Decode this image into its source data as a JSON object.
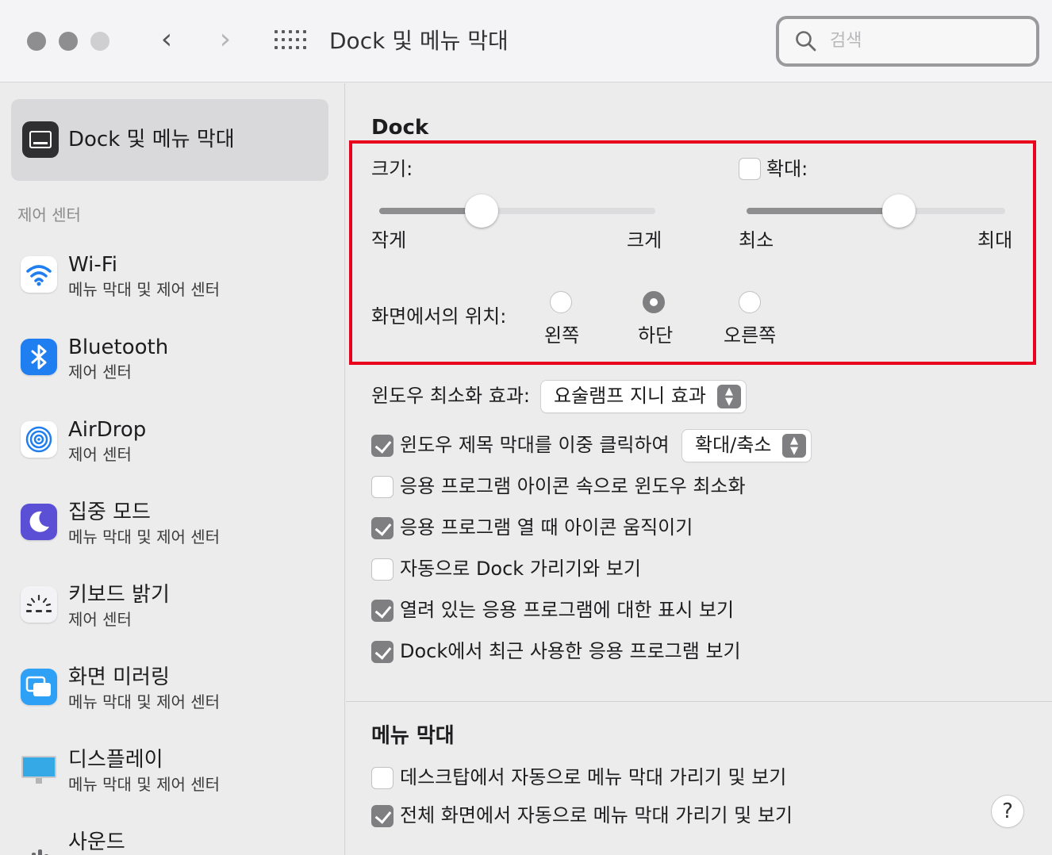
{
  "window": {
    "title": "Dock 및 메뉴 막대",
    "search_placeholder": "검색",
    "nav_back": "‹",
    "nav_forward": "›"
  },
  "sidebar": {
    "selected_label": "Dock 및 메뉴 막대",
    "section_header": "제어 센터",
    "items": [
      {
        "title": "Wi-Fi",
        "subtitle": "메뉴 막대 및 제어 센터",
        "icon": "wifi-icon"
      },
      {
        "title": "Bluetooth",
        "subtitle": "제어 센터",
        "icon": "bluetooth-icon"
      },
      {
        "title": "AirDrop",
        "subtitle": "제어 센터",
        "icon": "airdrop-icon"
      },
      {
        "title": "집중 모드",
        "subtitle": "메뉴 막대 및 제어 센터",
        "icon": "moon-icon"
      },
      {
        "title": "키보드 밝기",
        "subtitle": "제어 센터",
        "icon": "keyboard-brightness-icon"
      },
      {
        "title": "화면 미러링",
        "subtitle": "메뉴 막대 및 제어 센터",
        "icon": "screen-mirroring-icon"
      },
      {
        "title": "디스플레이",
        "subtitle": "메뉴 막대 및 제어 센터",
        "icon": "display-icon"
      },
      {
        "title": "사운드",
        "subtitle": "",
        "icon": "sound-icon"
      }
    ]
  },
  "dock": {
    "heading": "Dock",
    "size_label": "크기:",
    "size_min": "작게",
    "size_max": "크게",
    "size_value": 0.37,
    "magnify_label": "확대:",
    "magnify_checked": false,
    "magnify_min": "최소",
    "magnify_max": "최대",
    "magnify_value": 0.59,
    "position_label": "화면에서의 위치:",
    "position_options": [
      "왼쪽",
      "하단",
      "오른쪽"
    ],
    "position_selected": "하단",
    "minimize_label": "윈도우 최소화 효과:",
    "minimize_value": "요술램프 지니 효과",
    "options": [
      {
        "label": "윈도우 제목 막대를 이중 클릭하여",
        "checked": true
      },
      {
        "label": "응용 프로그램 아이콘 속으로 윈도우 최소화",
        "checked": false
      },
      {
        "label": "응용 프로그램 열 때 아이콘 움직이기",
        "checked": true
      },
      {
        "label": "자동으로 Dock 가리기와 보기",
        "checked": false
      },
      {
        "label": "열려 있는 응용 프로그램에 대한 표시 보기",
        "checked": true
      },
      {
        "label": "Dock에서 최근 사용한 응용 프로그램 보기",
        "checked": true
      }
    ],
    "double_click_value": "확대/축소"
  },
  "menubar": {
    "heading": "메뉴 막대",
    "options": [
      {
        "label": "데스크탑에서 자동으로 메뉴 막대 가리기 및 보기",
        "checked": false
      },
      {
        "label": "전체 화면에서 자동으로 메뉴 막대 가리기 및 보기",
        "checked": true
      }
    ]
  },
  "help_label": "?",
  "colors": {
    "highlight_box": "#e8001c",
    "control_gray": "#7f7f81"
  }
}
